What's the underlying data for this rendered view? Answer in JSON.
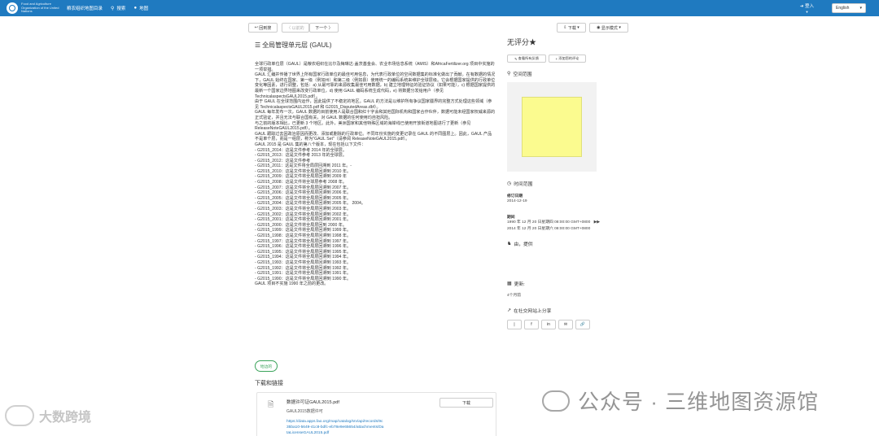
{
  "nav": {
    "brand": "Food and Agriculture Organization of the United Nations",
    "title": "粮农组织地图目录",
    "search": "搜索",
    "map": "地图",
    "login": "登入",
    "language": "English"
  },
  "toolbar": {
    "back": "回到搜",
    "prev": "〈 以前的",
    "next": "下一个 〉",
    "download": "下载",
    "display_mode": "显示模式"
  },
  "record": {
    "title": "全局管理单元层 (GAUL)",
    "abstract": [
      "全球行政单位层（GAUL）是粮农组织在比尔及梅琳达·盖茨基金会、农业市场信息系统（AMIS）和AfricaFertilizer.org 项目中实施的一项举措。",
      "GAUL 汇编并传播了世界上所有国家行政单位的最佳可用信息，为代表行政单位的空间数据集的标准化做出了贡献。在有数据的情况下，GAUL 始终在国家、第一级（例如州）和第二级（例如县）使用统一的编码系统来维护全球层级。它会根据国家提供的行政单位变化等因素，进行调整，包括：a) 从最可靠的来源收集最佳可用数据，b) 建立地理特征的验证协议（如果可能），c) 根据国家提供的最新一个国家边界地图来改变行政单位，d) 使用 GAUL 编码系统生成代码，e) 将数据分发给用户（参见 TechnicalaspectsGAUL2015.pdf）。",
      "由于 GAUL 在全球范围内运作，因此提供了不稳定的地区。GAUL 的方法是以维护所有争议国家疆界的完整方式处理这些领域（参见 TechnicalaspectsGAUL2015.pdf 和 G2015_DisputedAreas.dbf）。",
      "GAUL 每年发布一次，GAUL 数据的目前使用人是联合国和红十字会和其他国际机构和国家合作伙伴，数据可能未经国家权威来源的正式验证，并且无法与联合国有关，对 GAUL 数据的任何使用均自担风险。",
      "与之前的版本相比，已更新 3 个地区。此外，美洲国家和其他特殊区域的海岸线已使用开放街道地图进行了更新（参见ReleaseNoteGAUL2015.pdf）。",
      "GAUL 跟踪过去因政治原因而更改、添加或删除的行政单位。不同年份实施的变更记录在 GAUL 的不同图层上。因此，GAUL 产品不是单个层，而是一组层，称为\"GAUL Set\"（请参阅 ReleaseNoteGAUL2015.pdf）。",
      "GAUL 2015 是 GAUL 集的第八个版本，现在包括以下文件：",
      "- G2015_2014：这是文件参考 2014 年的全球层。",
      "- G2015_2013：这是文件参考 2013 年的全球层。",
      "- G2015_2012：这是文件参考",
      "- G2015_2011：这是文件将全局层回溯到 2011 年。-",
      "- G2015_2010：这是文件将全局层回溯到 2010 年。",
      "- G2015_2009：这是文件将全局层回溯到 2009 年",
      "- G2015_2008：这是文件将全球层参考 2008 年。",
      "- G2015_2007：这是文件将全局层回溯到 2007 年。",
      "- G2015_2006：这是文件将全局层回溯到 2006 年。",
      "- G2015_2005：这是文件将全局层回溯到 2005 年。",
      "- G2015_2004：这是文件将全局层回溯到 2005 年。 2004。",
      "- G2015_2003：这是文件将全局层回溯到 2003 年。",
      "- G2015_2002：这是文件将全局层回溯到 2002 年。",
      "- G2015_2001：这是文件将全局层回溯到 2001 年。",
      "- G2015_2000：这是文件将全局层回到 2000 年。",
      "- G2015_1999：这是文件将全局层回溯到 1999 年。",
      "- G2015_1998：这是文件将全局层回溯到 1998 年。",
      "- G2015_1997：这是文件将全局层回溯到 1997 年。",
      "- G2015_1996：这是文件将全局层回溯到 1996 年。",
      "- G2015_1995：这是文件将全局层回溯到 1995 年。",
      "- G2015_1994：这是文件将全局层回溯到 1994 年。",
      "- G2015_1993：这是文件将全局层回溯到 1993 年。",
      "- G2015_1992：这是文件将全局层回溯到 1992 年。",
      "- G2015_1991：这是文件将全局层回溯到 1991 年。",
      "- G2015_1990：这是文件将全局层回溯到 1990 年。",
      "GAUL 项目不实施 1990 年之前的更改。"
    ],
    "tag": "地边的",
    "downloads_heading": "下载和链接",
    "download_item": {
      "name": "数据许可证GAUL2015.pdf",
      "desc": "GAUL2015数据许可",
      "url": "https://data.apps.fao.org/map/catalog/srv/api/records/9c35ba10-5649-41c8-bdfc-eb78e9e65654/attachments/DataLicenseGAUL2015.pdf",
      "button": "下载"
    }
  },
  "sidebar": {
    "rating": "无评分",
    "view_feedback": "查看所有反馈",
    "add_review": "添加您的评论",
    "spatial_extent": "空间范围",
    "temporal_extent": "时间范围",
    "revision_date_label": "修订日期",
    "revision_date": "2014-12-19",
    "period_label": "期间",
    "period_start": "1990 年 12 月 20 日星期四 08:00:00 GMT+0800",
    "period_end": "2014 年 12 月 20 日星期六 08:00:00 GMT+0800",
    "provided_by": "由，提供",
    "updated_label": "更新:",
    "updated_value": "4个月前",
    "share_label": "在社交网站上分享"
  },
  "watermarks": {
    "left": "大数跨境",
    "right": "公众号 · 三维地图资源馆"
  }
}
